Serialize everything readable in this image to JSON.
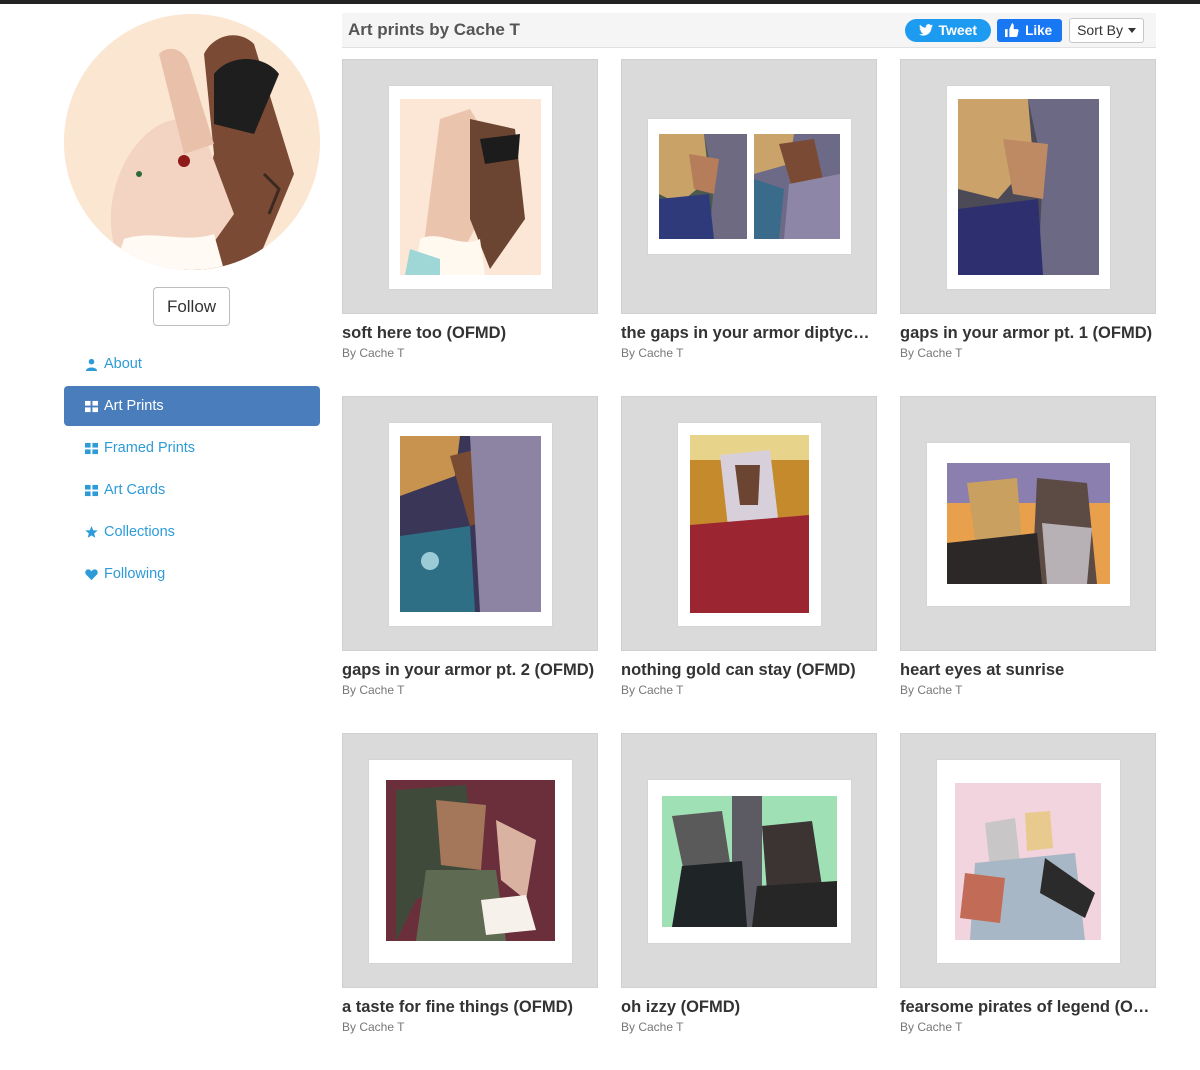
{
  "header": {
    "title": "Art prints by Cache T",
    "tweet_label": "Tweet",
    "like_label": "Like",
    "sort_label": "Sort By"
  },
  "profile": {
    "follow_label": "Follow"
  },
  "nav": [
    {
      "label": "About",
      "icon": "user-icon",
      "active": false
    },
    {
      "label": "Art Prints",
      "icon": "grid-icon",
      "active": true
    },
    {
      "label": "Framed Prints",
      "icon": "grid-icon",
      "active": false
    },
    {
      "label": "Art Cards",
      "icon": "grid-icon",
      "active": false
    },
    {
      "label": "Collections",
      "icon": "star-icon",
      "active": false
    },
    {
      "label": "Following",
      "icon": "heart-icon",
      "active": false
    }
  ],
  "products": [
    {
      "title": "soft here too (OFMD)",
      "by": "By Cache T"
    },
    {
      "title": "the gaps in your armor diptych…",
      "by": "By Cache T"
    },
    {
      "title": "gaps in your armor pt. 1 (OFMD)",
      "by": "By Cache T"
    },
    {
      "title": "gaps in your armor pt. 2 (OFMD)",
      "by": "By Cache T"
    },
    {
      "title": "nothing gold can stay (OFMD)",
      "by": "By Cache T"
    },
    {
      "title": "heart eyes at sunrise",
      "by": "By Cache T"
    },
    {
      "title": "a taste for fine things (OFMD)",
      "by": "By Cache T"
    },
    {
      "title": "oh izzy (OFMD)",
      "by": "By Cache T"
    },
    {
      "title": "fearsome pirates of legend (O…",
      "by": "By Cache T"
    }
  ],
  "colors": {
    "accent_link": "#2d9bd8",
    "active_nav": "#4a7dbb",
    "tweet": "#1d9bf0",
    "like": "#1877f2",
    "tile_bg": "#dadada"
  }
}
